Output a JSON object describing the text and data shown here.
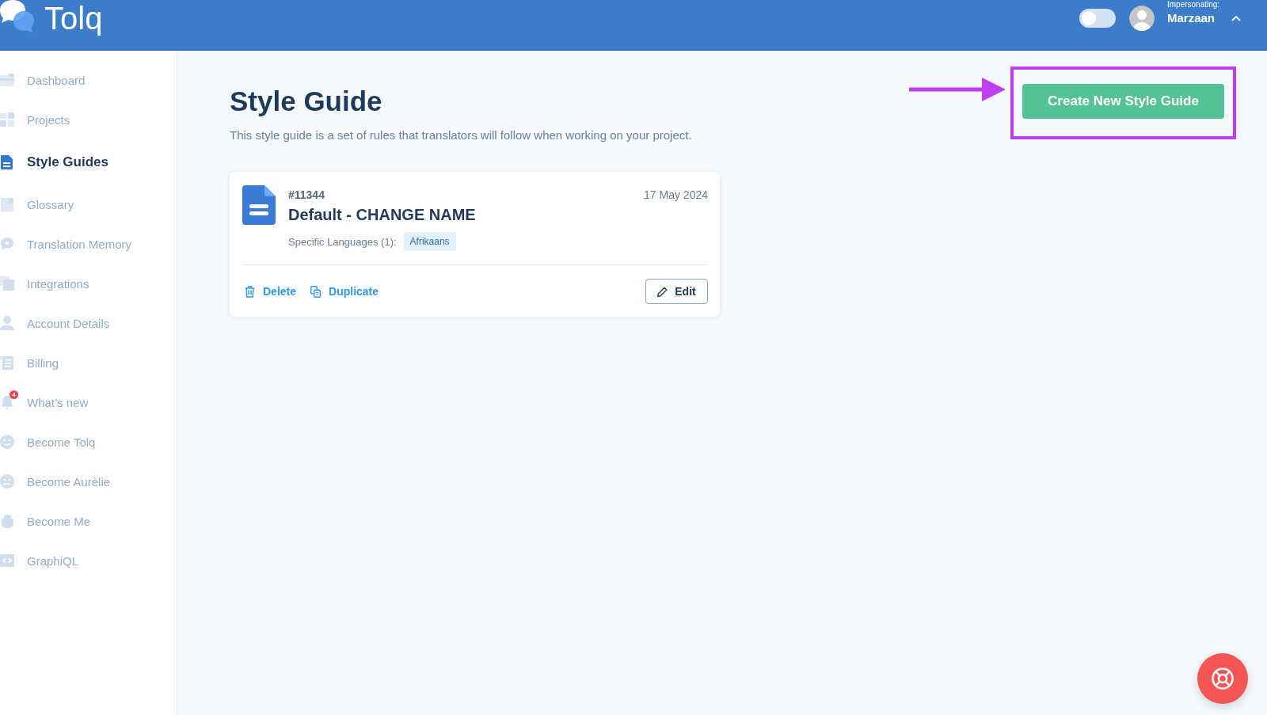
{
  "header": {
    "logo": "Tolq",
    "impersonation_toggle": {
      "on": false
    },
    "impersonating_label": "Impersonating:",
    "user_name": "Marzaan"
  },
  "sidebar": {
    "items": [
      {
        "label": "Dashboard",
        "selected": false
      },
      {
        "label": "Projects",
        "selected": false
      },
      {
        "label": "Style Guides",
        "selected": true
      },
      {
        "label": "Glossary",
        "selected": false
      },
      {
        "label": "Translation Memory",
        "selected": false
      },
      {
        "label": "Integrations",
        "selected": false
      },
      {
        "label": "Account Details",
        "selected": false
      },
      {
        "label": "Billing",
        "selected": false
      },
      {
        "label": "What’s new",
        "selected": false,
        "badge": "4"
      },
      {
        "label": "Become Tolq",
        "selected": false
      },
      {
        "label": "Become Aurèlie",
        "selected": false
      },
      {
        "label": "Become Me",
        "selected": false
      },
      {
        "label": "GraphiQL",
        "selected": false
      }
    ]
  },
  "page": {
    "title": "Style Guide",
    "description": "This style guide is a set of rules that translators will follow when working on your project.",
    "create_button": "Create New Style Guide"
  },
  "style_guides": [
    {
      "id": "#11344",
      "name": "Default - CHANGE NAME",
      "date": "17 May 2024",
      "languages_label": "Specific Languages (1):",
      "languages": [
        "Afrikaans"
      ],
      "delete_label": "Delete",
      "duplicate_label": "Duplicate",
      "edit_label": "Edit"
    }
  ]
}
